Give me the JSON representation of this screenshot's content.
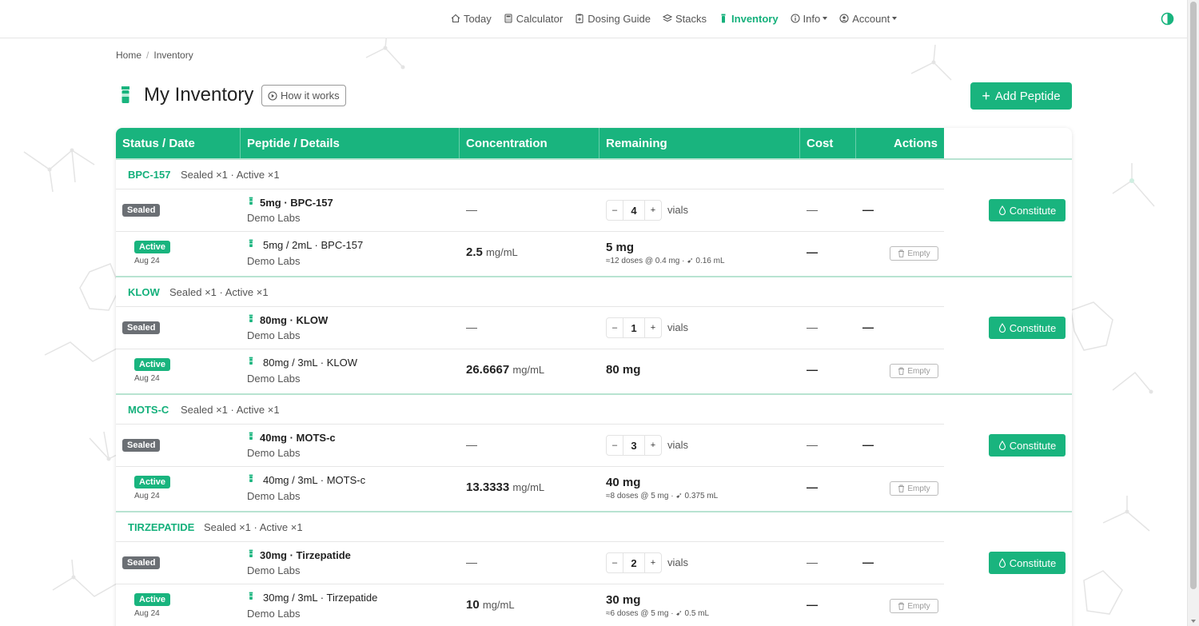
{
  "nav": {
    "items": [
      {
        "label": "Today",
        "icon": "home-icon",
        "active": false,
        "dropdown": false
      },
      {
        "label": "Calculator",
        "icon": "calculator-icon",
        "active": false,
        "dropdown": false
      },
      {
        "label": "Dosing Guide",
        "icon": "clipboard-icon",
        "active": false,
        "dropdown": false
      },
      {
        "label": "Stacks",
        "icon": "layers-icon",
        "active": false,
        "dropdown": false
      },
      {
        "label": "Inventory",
        "icon": "vial-icon",
        "active": true,
        "dropdown": false
      },
      {
        "label": "Info",
        "icon": "info-icon",
        "active": false,
        "dropdown": true
      },
      {
        "label": "Account",
        "icon": "user-circle-icon",
        "active": false,
        "dropdown": true
      }
    ],
    "theme_toggle_icon": "half-circle-icon"
  },
  "breadcrumb": {
    "home": "Home",
    "sep": "/",
    "current": "Inventory"
  },
  "page": {
    "title": "My Inventory",
    "how_it_works": "How it works",
    "add_peptide": "Add Peptide"
  },
  "table": {
    "headers": [
      "Status / Date",
      "Peptide / Details",
      "Concentration",
      "Remaining",
      "Cost",
      "Actions"
    ],
    "groups": [
      {
        "name": "BPC-157",
        "meta": "Sealed ×1 · Active ×1",
        "sealed": {
          "status": "Sealed",
          "name": "5mg · BPC-157",
          "vendor": "Demo Labs",
          "concentration": "—",
          "qty": "4",
          "qty_unit": "vials",
          "cost": "—",
          "cost2": "—",
          "action": "Constitute"
        },
        "active": {
          "status": "Active",
          "date": "Aug 24",
          "name": "5mg / 2mL · BPC-157",
          "vendor": "Demo Labs",
          "concentration": "2.5",
          "conc_unit": "mg/mL",
          "remaining": "5 mg",
          "remaining_note": "≈12 doses @ 0.4 mg · ➹ 0.16 mL",
          "cost": "—",
          "action": "Empty"
        }
      },
      {
        "name": "KLOW",
        "meta": "Sealed ×1 · Active ×1",
        "sealed": {
          "status": "Sealed",
          "name": "80mg · KLOW",
          "vendor": "Demo Labs",
          "concentration": "—",
          "qty": "1",
          "qty_unit": "vials",
          "cost": "—",
          "cost2": "—",
          "action": "Constitute"
        },
        "active": {
          "status": "Active",
          "date": "Aug 24",
          "name": "80mg / 3mL · KLOW",
          "vendor": "Demo Labs",
          "concentration": "26.6667",
          "conc_unit": "mg/mL",
          "remaining": "80 mg",
          "remaining_note": "",
          "cost": "—",
          "action": "Empty"
        }
      },
      {
        "name": "MOTS-C",
        "meta": "Sealed ×1 · Active ×1",
        "sealed": {
          "status": "Sealed",
          "name": "40mg · MOTS-c",
          "vendor": "Demo Labs",
          "concentration": "—",
          "qty": "3",
          "qty_unit": "vials",
          "cost": "—",
          "cost2": "—",
          "action": "Constitute"
        },
        "active": {
          "status": "Active",
          "date": "Aug 24",
          "name": "40mg / 3mL · MOTS-c",
          "vendor": "Demo Labs",
          "concentration": "13.3333",
          "conc_unit": "mg/mL",
          "remaining": "40 mg",
          "remaining_note": "≈8 doses @ 5 mg · ➹ 0.375 mL",
          "cost": "—",
          "action": "Empty"
        }
      },
      {
        "name": "TIRZEPATIDE",
        "meta": "Sealed ×1 · Active ×1",
        "sealed": {
          "status": "Sealed",
          "name": "30mg · Tirzepatide",
          "vendor": "Demo Labs",
          "concentration": "—",
          "qty": "2",
          "qty_unit": "vials",
          "cost": "—",
          "cost2": "—",
          "action": "Constitute"
        },
        "active": {
          "status": "Active",
          "date": "Aug 24",
          "name": "30mg / 3mL · Tirzepatide",
          "vendor": "Demo Labs",
          "concentration": "10",
          "conc_unit": "mg/mL",
          "remaining": "30 mg",
          "remaining_note": "≈6 doses @ 5 mg · ➹ 0.5 mL",
          "cost": "—",
          "action": "Empty"
        }
      }
    ]
  },
  "colors": {
    "accent": "#19b47e",
    "sealed_badge": "#6b6f74",
    "group_divider": "#b8e3d1"
  }
}
